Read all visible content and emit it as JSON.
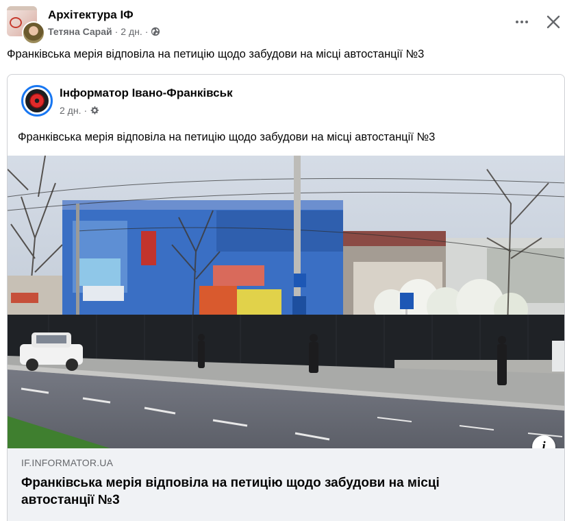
{
  "post": {
    "group_name": "Архітектура ІФ",
    "author": "Тетяна Сарай",
    "time": "2 дн.",
    "separator": "·",
    "text": "Франківська мерія відповіла на петицію щодо забудови на місці автостанції №3"
  },
  "shared": {
    "page_name": "Інформатор Івано-Франківськ",
    "time": "2 дн.",
    "separator": "·",
    "text": "Франківська мерія відповіла на петицію щодо забудови на місці автостанції №3",
    "link": {
      "domain": "IF.INFORMATOR.UA",
      "title": "Франківська мерія відповіла на петицію щодо забудови на місці автостанції №3"
    },
    "info_glyph": "i"
  },
  "icons": {
    "privacy": "globe-icon",
    "page_privacy": "gear-icon",
    "more": "more-dots-icon",
    "close": "close-icon",
    "info": "info-icon"
  },
  "colors": {
    "primary_text": "#050505",
    "secondary_text": "#65676b",
    "link_bg": "#f0f2f5",
    "accent_blue": "#1877f2"
  }
}
